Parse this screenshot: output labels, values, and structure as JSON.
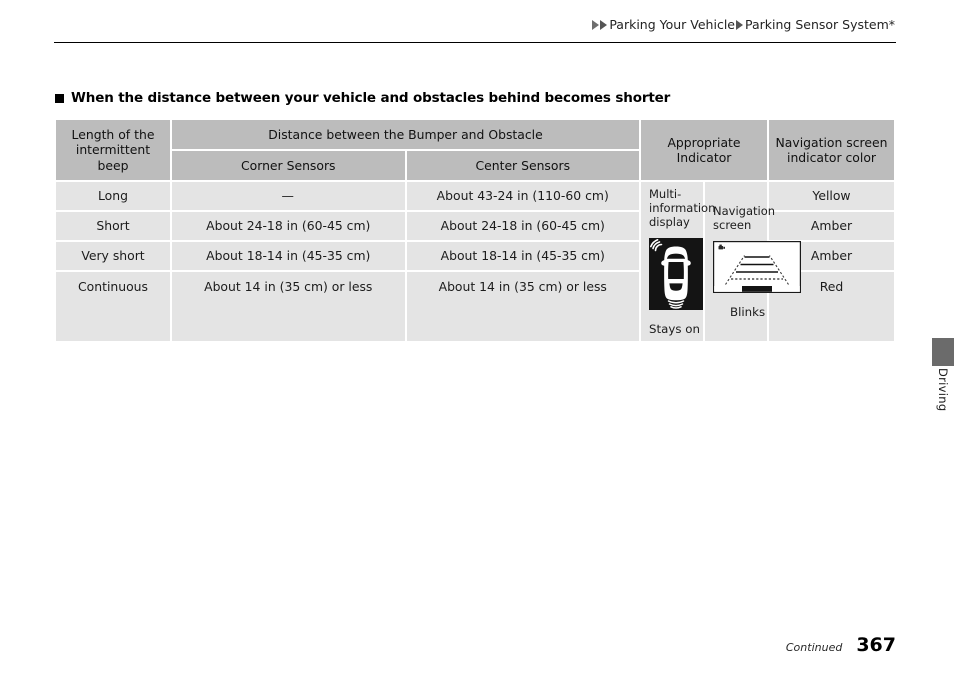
{
  "header": {
    "breadcrumb": {
      "items": [
        "Parking Your Vehicle",
        "Parking Sensor System*"
      ],
      "arrow_icon": "triangle-right-icon"
    }
  },
  "section": {
    "heading": "When the distance between your vehicle and obstacles behind becomes shorter",
    "bullet_icon": "square-bullet-icon"
  },
  "table": {
    "headers": {
      "beep": "Length of the intermittent beep",
      "distance_group": "Distance between the Bumper and Obstacle",
      "corner_sensors": "Corner Sensors",
      "center_sensors": "Center Sensors",
      "appropriate_indicator": "Appropriate Indicator",
      "nav_color": "Navigation screen indicator color"
    },
    "rows": [
      {
        "beep": "Long",
        "corner": "—",
        "center": "About 43-24 in (110-60 cm)",
        "color": "Yellow"
      },
      {
        "beep": "Short",
        "corner": "About 24-18 in (60-45 cm)",
        "center": "About 24-18 in (60-45 cm)",
        "color": "Amber"
      },
      {
        "beep": "Very short",
        "corner": "About 18-14 in (45-35 cm)",
        "center": "About 18-14 in (45-35 cm)",
        "color": "Amber"
      },
      {
        "beep": "Continuous",
        "corner": "About 14 in (35 cm) or less",
        "center": "About 14 in (35 cm) or less",
        "color": "Red"
      }
    ],
    "indicator": {
      "multi_info_label": "Multi-information display",
      "multi_info_caption": "Stays on",
      "multi_info_icon": "vehicle-top-view-sensor-icon",
      "nav_screen_label": "Navigation screen",
      "nav_screen_caption": "Blinks",
      "nav_screen_icon": "rear-camera-guideline-icon"
    }
  },
  "side_tab": {
    "label": "Driving"
  },
  "footer": {
    "continued": "Continued",
    "page_number": "367"
  }
}
